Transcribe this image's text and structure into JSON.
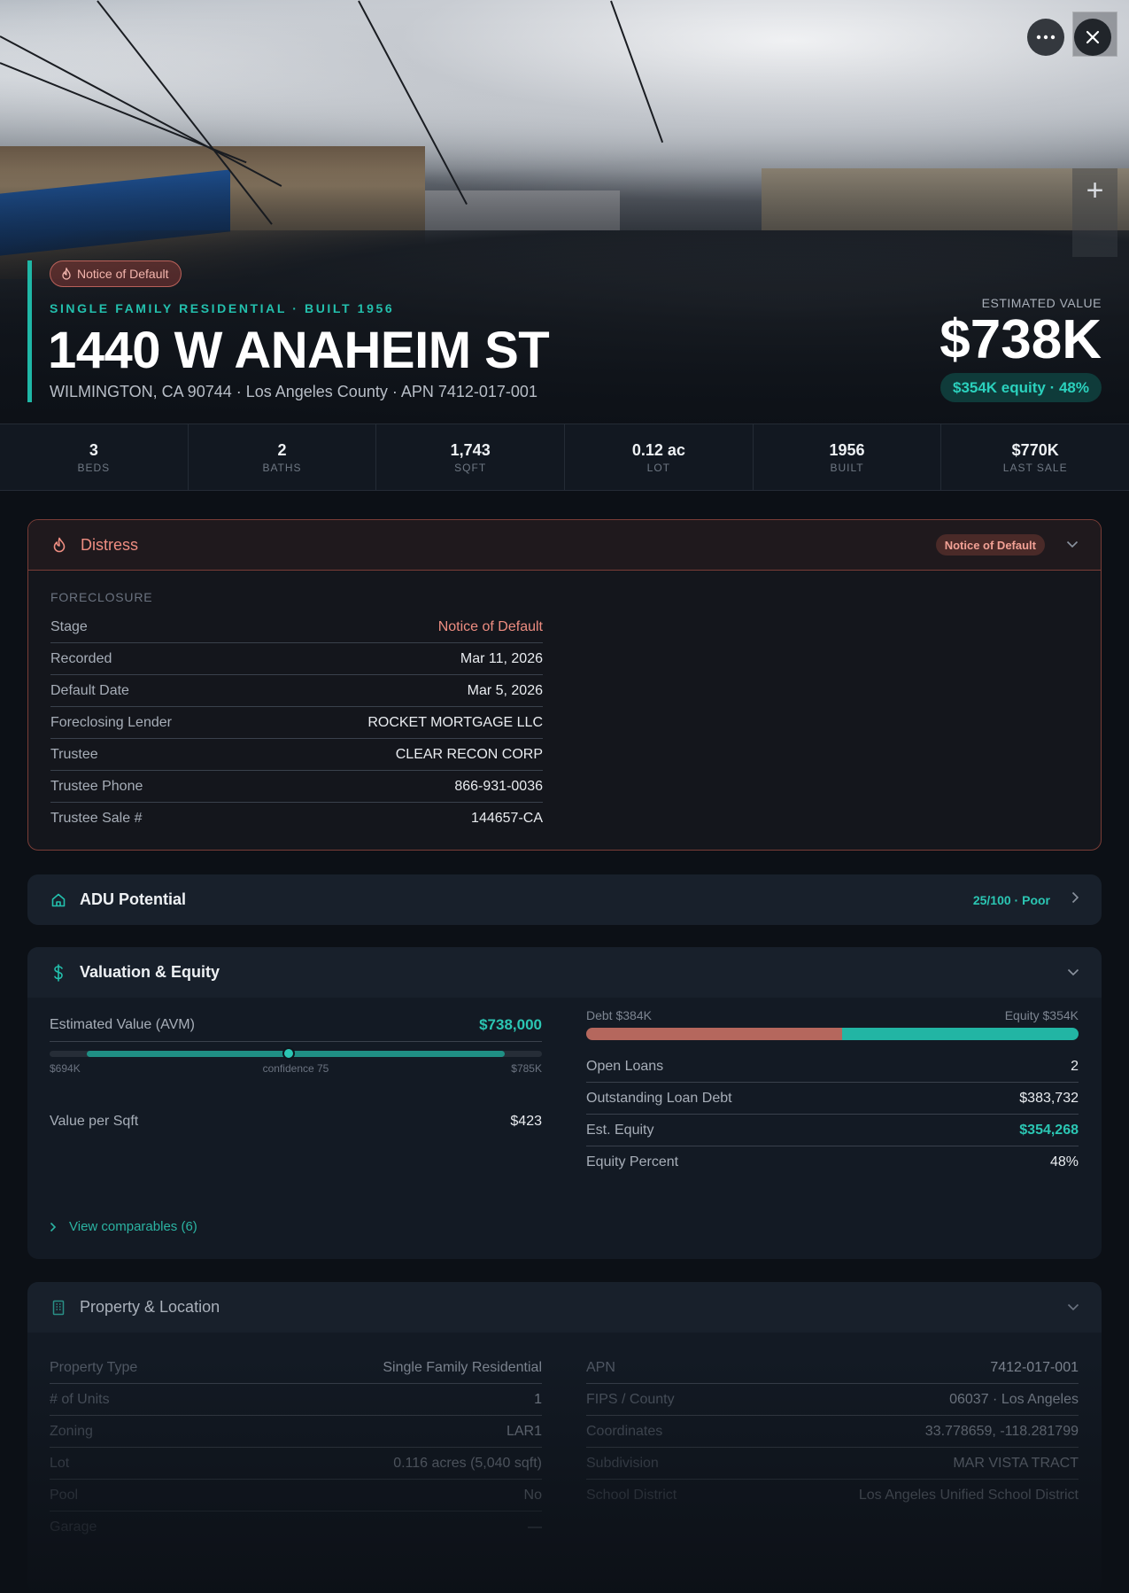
{
  "hero": {
    "distress_pill": "Notice of Default",
    "subtitle": "SINGLE FAMILY RESIDENTIAL · BUILT 1956",
    "title": "1440 W ANAHEIM ST",
    "address": "WILMINGTON, CA 90744 · Los Angeles County · APN 7412-017-001",
    "estimated_label": "ESTIMATED VALUE",
    "estimated_value": "$738K",
    "equity_pill": "$354K equity · 48%",
    "more_icon": "more-horizontal-icon",
    "close_icon": "close-icon",
    "zoom_in_label": "+"
  },
  "stats": [
    {
      "value": "3",
      "label": "BEDS"
    },
    {
      "value": "2",
      "label": "BATHS"
    },
    {
      "value": "1,743",
      "label": "SQFT"
    },
    {
      "value": "0.12 ac",
      "label": "LOT"
    },
    {
      "value": "1956",
      "label": "BUILT"
    },
    {
      "value": "$770K",
      "label": "LAST SALE"
    }
  ],
  "distress": {
    "title": "Distress",
    "badge": "Notice of Default",
    "section": "FORECLOSURE",
    "rows": [
      {
        "k": "Stage",
        "v": "Notice of Default"
      },
      {
        "k": "Recorded",
        "v": "Mar 11, 2026"
      },
      {
        "k": "Default Date",
        "v": "Mar 5, 2026"
      },
      {
        "k": "Foreclosing Lender",
        "v": "ROCKET MORTGAGE LLC"
      },
      {
        "k": "Trustee",
        "v": "CLEAR RECON CORP"
      },
      {
        "k": "Trustee Phone",
        "v": "866-931-0036"
      },
      {
        "k": "Trustee Sale #",
        "v": "144657-CA"
      }
    ]
  },
  "adu": {
    "title": "ADU Potential",
    "score": "25/100 · Poor"
  },
  "valuation": {
    "title": "Valuation & Equity",
    "avm_label": "Estimated Value (AVM)",
    "avm_value": "$738,000",
    "range_low": "$694K",
    "range_mid": "confidence 75",
    "range_high": "$785K",
    "range_low_value": 694,
    "range_high_value": 785,
    "range_point_value": 738,
    "vps_label": "Value per Sqft",
    "vps_value": "$423",
    "debt_label": "Debt $384K",
    "equity_label": "Equity $354K",
    "debt_share": 0.52,
    "rows": [
      {
        "k": "Open Loans",
        "v": "2"
      },
      {
        "k": "Outstanding Loan Debt",
        "v": "$383,732"
      },
      {
        "k": "Est. Equity",
        "v": "$354,268"
      },
      {
        "k": "Equity Percent",
        "v": "48%"
      }
    ],
    "comparables": "View comparables (6)"
  },
  "property": {
    "title": "Property & Location",
    "left": [
      {
        "k": "Property Type",
        "v": "Single Family Residential"
      },
      {
        "k": "# of Units",
        "v": "1"
      },
      {
        "k": "Zoning",
        "v": "LAR1"
      },
      {
        "k": "Lot",
        "v": "0.116 acres (5,040 sqft)"
      },
      {
        "k": "Pool",
        "v": "No"
      },
      {
        "k": "Garage",
        "v": "—"
      }
    ],
    "right": [
      {
        "k": "APN",
        "v": "7412-017-001"
      },
      {
        "k": "FIPS / County",
        "v": "06037 · Los Angeles"
      },
      {
        "k": "Coordinates",
        "v": "33.778659, -118.281799"
      },
      {
        "k": "Subdivision",
        "v": "MAR VISTA TRACT"
      },
      {
        "k": "School District",
        "v": "Los Angeles Unified School District"
      }
    ]
  },
  "colors": {
    "accent": "#23c0ad",
    "distress": "#ee8d81",
    "debt": "#b5675d",
    "equity": "#22b5a4"
  }
}
